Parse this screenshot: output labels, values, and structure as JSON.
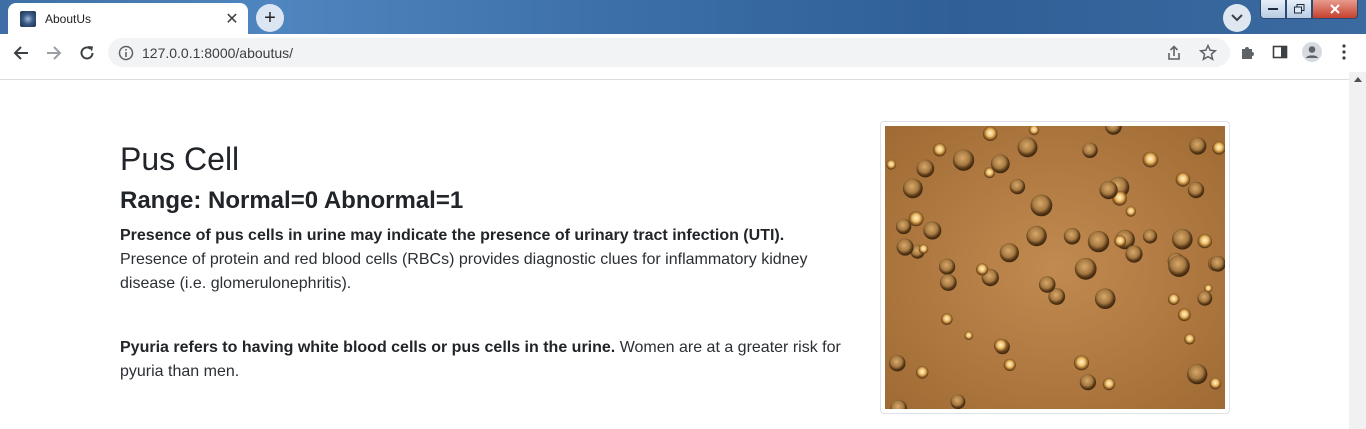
{
  "browser": {
    "tab_title": "AboutUs",
    "close_tab_symbol": "✕",
    "new_tab_symbol": "+",
    "url": "127.0.0.1:8000/aboutus/"
  },
  "page": {
    "title": "Pus Cell",
    "range": "Range: Normal=0 Abnormal=1",
    "para1_bold": "Presence of pus cells in urine may indicate the presence of urinary tract infection (UTI).",
    "para1_text": "Presence of protein and red blood cells (RBCs) provides diagnostic clues for inflammatory kidney disease (i.e. glomerulonephritis).",
    "para2_bold": "Pyuria refers to having white blood cells or pus cells in the urine.",
    "para2_text": "Women are at a greater risk for pyuria than men.",
    "image": {
      "icon": "microscope-image",
      "background_color": "#b07a42"
    }
  },
  "colors": {
    "titlebar": "#3f6ea6",
    "toolbar": "#ffffff",
    "omnibox": "#f1f3f4",
    "text": "#212529"
  }
}
